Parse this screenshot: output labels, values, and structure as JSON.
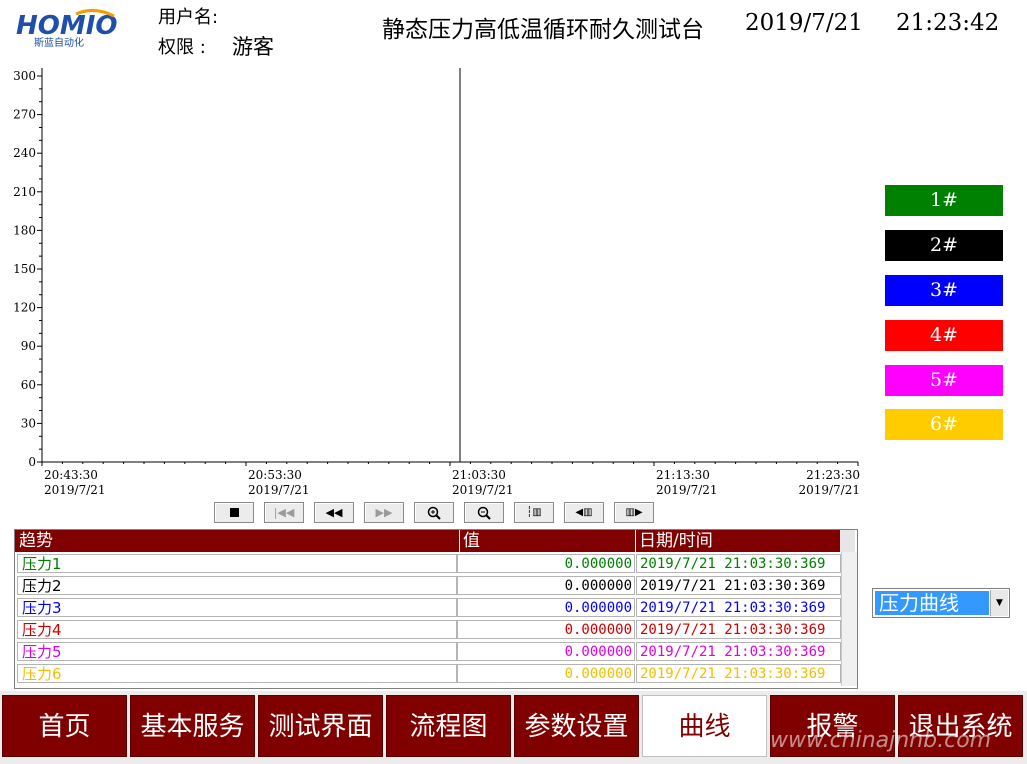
{
  "header": {
    "logo_text": "HOMIO",
    "logo_subtext": "斯蓝自动化",
    "user_label": "用户名:",
    "permission_label": "权限 :",
    "permission_value": "游客",
    "title": "静态压力高低温循环耐久测试台",
    "date": "2019/7/21",
    "time": "21:23:42"
  },
  "chart_data": {
    "type": "line",
    "title": "",
    "xlabel": "",
    "ylabel": "",
    "ylim": [
      0,
      300
    ],
    "y_ticks": [
      0,
      30,
      60,
      90,
      120,
      150,
      180,
      210,
      240,
      270,
      300
    ],
    "x_ticks": [
      {
        "time": "20:43:30",
        "date": "2019/7/21"
      },
      {
        "time": "20:53:30",
        "date": "2019/7/21"
      },
      {
        "time": "21:03:30",
        "date": "2019/7/21"
      },
      {
        "time": "21:13:30",
        "date": "2019/7/21"
      },
      {
        "time": "21:23:30",
        "date": "2019/7/21"
      }
    ],
    "cursor_at": "21:03:30",
    "series": []
  },
  "legend": [
    {
      "label": "1#",
      "color": "#008000"
    },
    {
      "label": "2#",
      "color": "#000000"
    },
    {
      "label": "3#",
      "color": "#0000ff"
    },
    {
      "label": "4#",
      "color": "#ff0000"
    },
    {
      "label": "5#",
      "color": "#ff00ff"
    },
    {
      "label": "6#",
      "color": "#ffcc00"
    }
  ],
  "controls": [
    "stop-icon",
    "first-icon",
    "rewind-icon",
    "forward-icon",
    "zoom-in-icon",
    "zoom-out-icon",
    "cursor-icon",
    "cursor-left-icon",
    "cursor-right-icon"
  ],
  "table": {
    "headers": {
      "trend": "趋势",
      "value": "值",
      "datetime": "日期/时间"
    },
    "rows": [
      {
        "name": "压力1",
        "value": "0.000000",
        "datetime": "2019/7/21  21:03:30:369",
        "color": "#008000"
      },
      {
        "name": "压力2",
        "value": "0.000000",
        "datetime": "2019/7/21  21:03:30:369",
        "color": "#000000"
      },
      {
        "name": "压力3",
        "value": "0.000000",
        "datetime": "2019/7/21  21:03:30:369",
        "color": "#0000ff"
      },
      {
        "name": "压力4",
        "value": "0.000000",
        "datetime": "2019/7/21  21:03:30:369",
        "color": "#cc0000"
      },
      {
        "name": "压力5",
        "value": "0.000000",
        "datetime": "2019/7/21  21:03:30:369",
        "color": "#e000e0"
      },
      {
        "name": "压力6",
        "value": "0.000000",
        "datetime": "2019/7/21  21:03:30:369",
        "color": "#f0c000"
      }
    ]
  },
  "curve_select": {
    "value": "压力曲线"
  },
  "nav": {
    "tabs": [
      "首页",
      "基本服务",
      "测试界面",
      "流程图",
      "参数设置",
      "曲线",
      "报警",
      "退出系统"
    ],
    "active_index": 5
  },
  "watermark": "www.chinajnhb.com"
}
